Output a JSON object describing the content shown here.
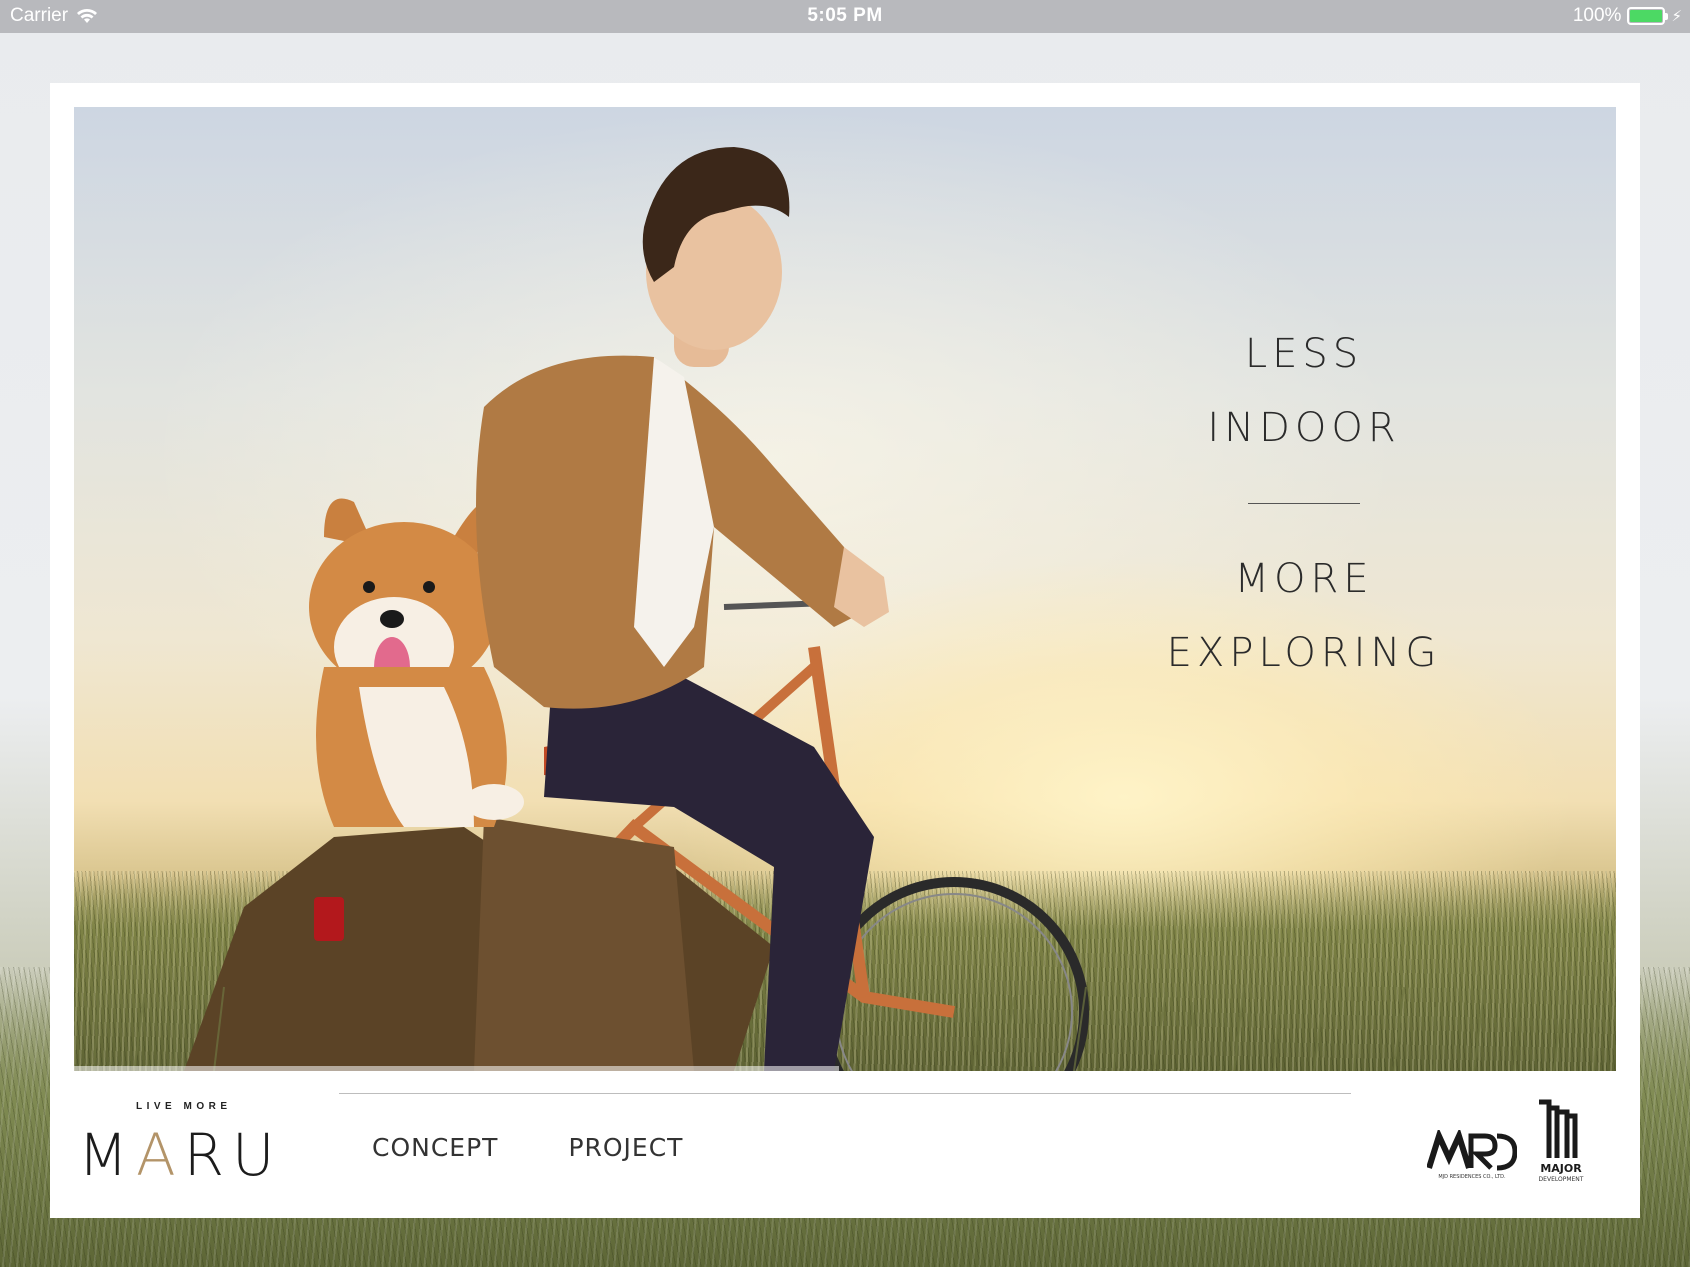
{
  "status_bar": {
    "carrier": "Carrier",
    "time": "5:05 PM",
    "battery": "100%",
    "battery_level": 1.0
  },
  "hero": {
    "tagline_top": [
      "LESS",
      "INDOOR"
    ],
    "tagline_bottom": [
      "MORE",
      "EXPLORING"
    ]
  },
  "brand": {
    "tagline": "LIVE MORE",
    "name_start": "M",
    "name_accent": "A",
    "name_end": "RU",
    "accent_color": "#b39469"
  },
  "nav": {
    "items": [
      "CONCEPT",
      "PROJECT"
    ]
  },
  "partners": {
    "mrd": {
      "logo_text": "MRD",
      "subtext": "MJD RESIDENCES CO., LTD."
    },
    "major": {
      "logo_text": "MAJOR",
      "subtext": "DEVELOPMENT"
    }
  }
}
